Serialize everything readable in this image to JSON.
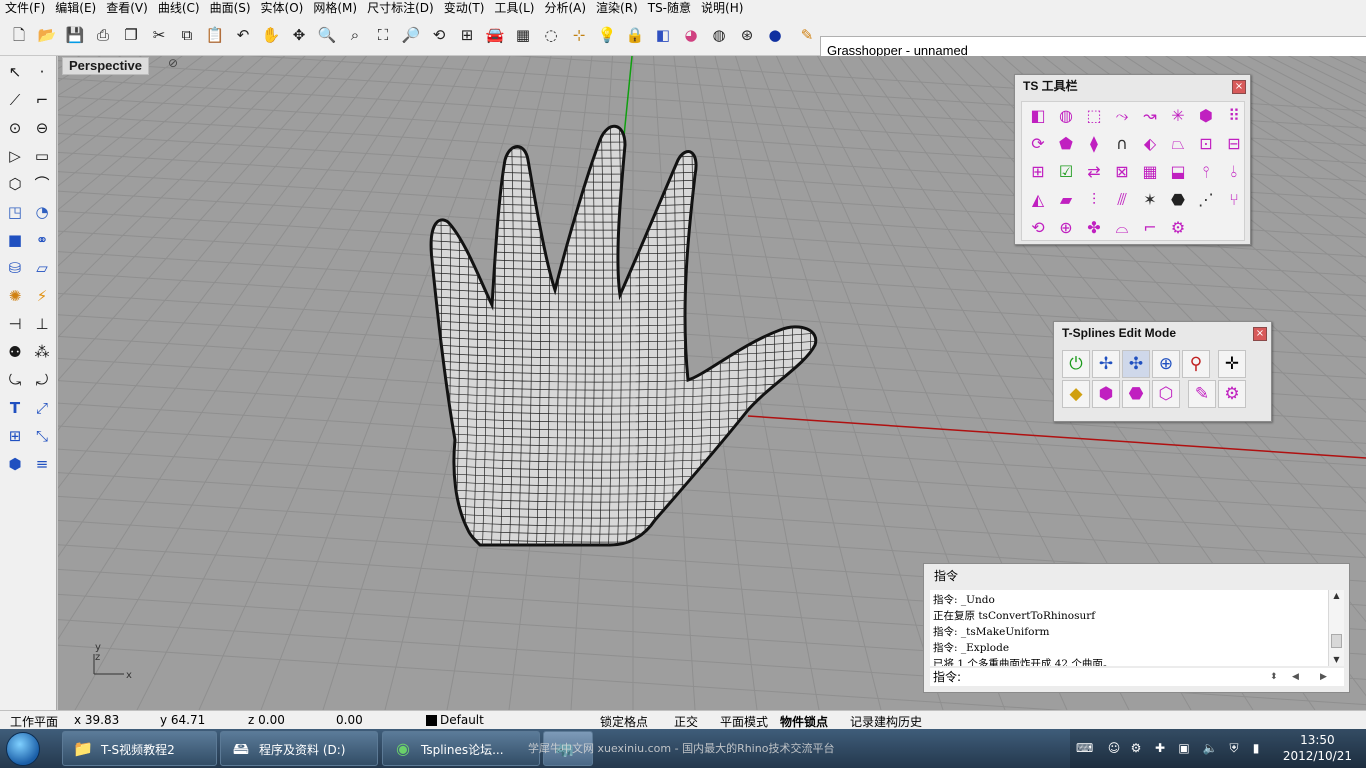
{
  "menu": [
    "文件(F)",
    "编辑(E)",
    "查看(V)",
    "曲线(C)",
    "曲面(S)",
    "实体(O)",
    "网格(M)",
    "尺寸标注(D)",
    "变动(T)",
    "工具(L)",
    "分析(A)",
    "渲染(R)",
    "TS-随意",
    "说明(H)"
  ],
  "toolbar_icons": [
    "new-file-icon",
    "open-folder-icon",
    "save-icon",
    "print-icon",
    "copy-page-icon",
    "cut-icon",
    "copy-icon",
    "paste-icon",
    "undo-icon",
    "pan-hand-icon",
    "rotate-view-icon",
    "zoom-icon",
    "zoom-window-icon",
    "zoom-extents-icon",
    "zoom-selected-icon",
    "rotate-camera-icon",
    "four-viewports-icon",
    "car-icon",
    "surface-grid-icon",
    "circle-dash-icon",
    "snap-icon",
    "light-bulb-icon",
    "lock-icon",
    "layer-icon",
    "color-wheel-icon",
    "sphere-wire-icon",
    "sphere-mesh-icon",
    "sphere-shaded-icon",
    "pen-icon"
  ],
  "grasshopper_title": "Grasshopper - unnamed",
  "viewport": {
    "name": "Perspective",
    "axis_y": "y",
    "axis_z": "z",
    "axis_x": "x"
  },
  "ts_toolbar": {
    "title": "TS 工具栏",
    "close": "×"
  },
  "edit_mode": {
    "title": "T-Splines Edit Mode",
    "close": "×"
  },
  "command": {
    "title": "指令",
    "history": [
      "指令: _Undo",
      "正在复原 tsConvertToRhinosurf",
      "指令: _tsMakeUniform",
      "指令: _Explode",
      "已将 1 个多重曲面炸开成 42 个曲面。"
    ],
    "prompt": "指令:"
  },
  "status": {
    "cplane": "工作平面",
    "x": "x 39.83",
    "y": "y 64.71",
    "z": "z 0.00",
    "dist": "0.00",
    "layer": "Default",
    "grid_snap": "锁定格点",
    "ortho": "正交",
    "planar": "平面模式",
    "osnap": "物件锁点",
    "history": "记录建构历史"
  },
  "taskbar": {
    "tasks": [
      {
        "icon": "folder-icon",
        "label": "T-S视频教程2"
      },
      {
        "icon": "drive-icon",
        "label": "程序及资料 (D:)"
      },
      {
        "icon": "browser-icon",
        "label": "Tsplines论坛..."
      },
      {
        "icon": "rhino-icon",
        "label": ""
      }
    ],
    "watermark": "学犀牛中文网 xuexiniu.com - 国内最大的Rhino技术交流平台",
    "time": "13:50",
    "date": "2012/10/21"
  },
  "colors": {
    "viewport_bg": "#9e9e9e",
    "grid_line": "#8e8e8e",
    "x_axis": "#b01010",
    "y_axis": "#10a010",
    "ts_icon": "#c020c0",
    "panel_bg": "#e8e8e8"
  }
}
